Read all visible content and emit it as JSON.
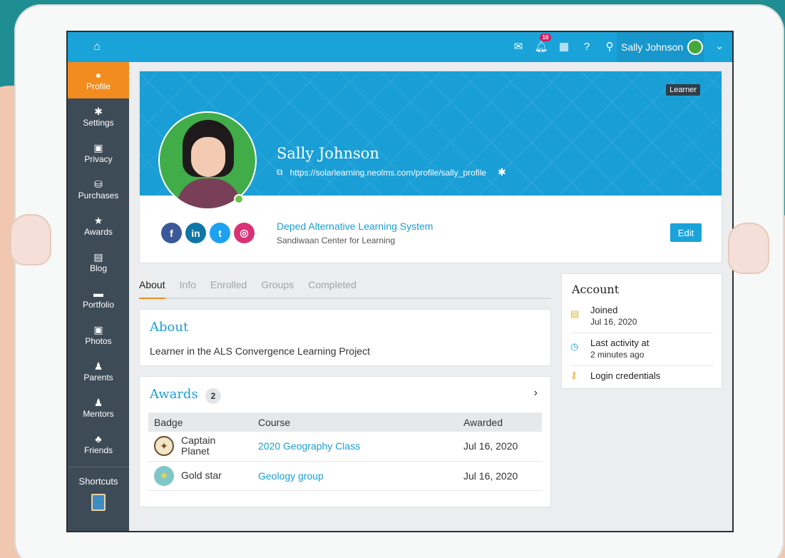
{
  "topbar": {
    "home_icon": "home-icon",
    "notification_count": "10",
    "user_name": "Sally Johnson"
  },
  "sidebar": {
    "items": [
      {
        "label": "Profile",
        "icon": "info-icon",
        "glyph": "●"
      },
      {
        "label": "Settings",
        "icon": "gear-icon",
        "glyph": "✱"
      },
      {
        "label": "Privacy",
        "icon": "lock-icon",
        "glyph": "▣"
      },
      {
        "label": "Purchases",
        "icon": "coins-icon",
        "glyph": "⛁"
      },
      {
        "label": "Awards",
        "icon": "star-icon",
        "glyph": "★"
      },
      {
        "label": "Blog",
        "icon": "blog-icon",
        "glyph": "▤"
      },
      {
        "label": "Portfolio",
        "icon": "folder-icon",
        "glyph": "▬"
      },
      {
        "label": "Photos",
        "icon": "image-icon",
        "glyph": "▣"
      },
      {
        "label": "Parents",
        "icon": "person-icon",
        "glyph": "♟"
      },
      {
        "label": "Mentors",
        "icon": "person-icon",
        "glyph": "♟"
      },
      {
        "label": "Friends",
        "icon": "friends-icon",
        "glyph": "♣"
      }
    ],
    "shortcuts_label": "Shortcuts"
  },
  "profile": {
    "role": "Learner",
    "name": "Sally Johnson",
    "url": "https://solarlearning.neolms.com/profile/sally_profile",
    "org_name": "Deped Alternative Learning System",
    "org_sub": "Sandiwaan Center for Learning",
    "edit_label": "Edit",
    "socials": [
      "f",
      "in",
      "t",
      "◎"
    ]
  },
  "tabs": [
    "About",
    "Info",
    "Enrolled",
    "Groups",
    "Completed"
  ],
  "about": {
    "title": "About",
    "text": "Learner in the ALS Convergence Learning Project"
  },
  "awards": {
    "title": "Awards",
    "count": "2",
    "columns": [
      "Badge",
      "Course",
      "Awarded"
    ],
    "rows": [
      {
        "badge": "Captain\nPlanet",
        "course": "2020 Geography Class",
        "awarded": "Jul 16, 2020"
      },
      {
        "badge": "Gold star",
        "course": "Geology group",
        "awarded": "Jul 16, 2020"
      }
    ]
  },
  "account": {
    "title": "Account",
    "joined_label": "Joined",
    "joined_date": "Jul 16, 2020",
    "activity_label": "Last activity at",
    "activity_value": "2 minutes ago",
    "credentials_label": "Login credentials"
  },
  "colors": {
    "accent": "#1aa3d9",
    "active_nav": "#f28c1f",
    "sidebar": "#3d4b57"
  }
}
